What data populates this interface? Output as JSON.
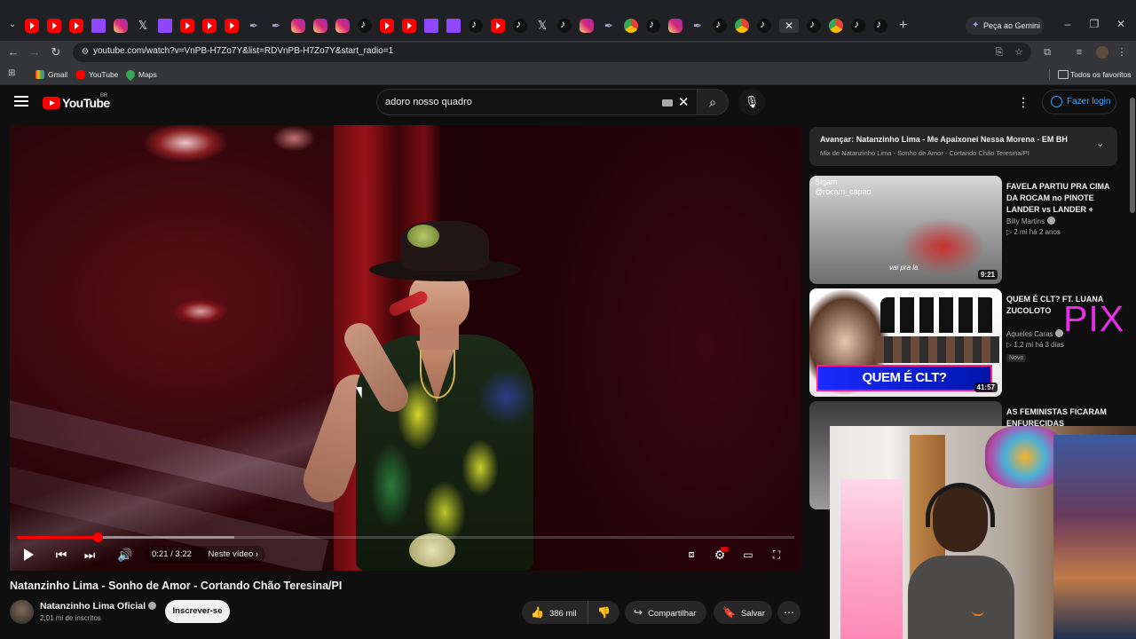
{
  "browser": {
    "tabs": [
      "yt",
      "yt",
      "yt",
      "twitch",
      "insta",
      "x",
      "twitch",
      "yt",
      "yt",
      "yt",
      "feather",
      "feather",
      "insta",
      "insta",
      "insta",
      "tiktok",
      "yt",
      "yt",
      "twitch",
      "twitch",
      "tiktok",
      "yt",
      "tiktok",
      "x",
      "tiktok",
      "insta",
      "feather",
      "chrome",
      "tiktok",
      "insta",
      "feather",
      "tiktok",
      "chrome",
      "tiktok",
      "active-x",
      "tiktok",
      "chrome",
      "tiktok",
      "tiktok"
    ],
    "gemini_label": "Peça ao Gemini",
    "url": "youtube.com/watch?v=VnPB-H7Zo7Y&list=RDVnPB-H7Zo7Y&start_radio=1",
    "bookmarks": [
      {
        "label": "Gmail",
        "kind": "gmail"
      },
      {
        "label": "YouTube",
        "kind": "yt"
      },
      {
        "label": "Maps",
        "kind": "maps"
      }
    ],
    "all_bookmarks_label": "Todos os favoritos"
  },
  "header": {
    "logo_text": "YouTube",
    "country_code": "BR",
    "search_query": "adoro nosso quadro",
    "login_label": "Fazer login"
  },
  "player": {
    "current_time": "0:21",
    "duration": "3:22",
    "time_label": "0:21 / 3:22",
    "next_video_label": "Neste vídeo",
    "played_fraction": 0.104,
    "buffered_fraction": 0.28
  },
  "video": {
    "title": "Natanzinho Lima - Sonho de Amor - Cortando Chão Teresina/PI",
    "channel": "Natanzinho Lima Oficial",
    "subscribers": "2,01 mi de inscritos",
    "subscribe_label": "Inscrever-se",
    "likes": "386 mil",
    "share_label": "Compartilhar",
    "save_label": "Salvar"
  },
  "queue": {
    "next_prefix": "Avançar:",
    "next_title": "Natanzinho Lima - Me Apaixonei Nessa Morena - EM BH",
    "mix_title": "Mix de Natanzinho Lima - Sonho de Amor - Cortando Chão Teresina/PI"
  },
  "recommendations": [
    {
      "title": "FAVELA PARTIU PRA CIMA DA ROCAM no PINOTE LANDER vs LANDER +",
      "channel": "Billy Martins",
      "meta": "▷ 2 mi  há 2 anos",
      "duration": "9:21",
      "thumb_text": "Sigam\n@rocam_capao",
      "thumb_caption": "vai pra la"
    },
    {
      "title": "QUEM É CLT? FT. LUANA ZUCOLOTO",
      "channel": "Aqueles Caras",
      "meta": "▷ 1,2 mi  há 3 dias",
      "duration": "41:57",
      "badge": "Novo",
      "thumb_banner": "QUEM É CLT?"
    },
    {
      "title": "AS FEMINISTAS FICARAM ENFURECIDAS"
    }
  ],
  "overlay_text": "PIX"
}
